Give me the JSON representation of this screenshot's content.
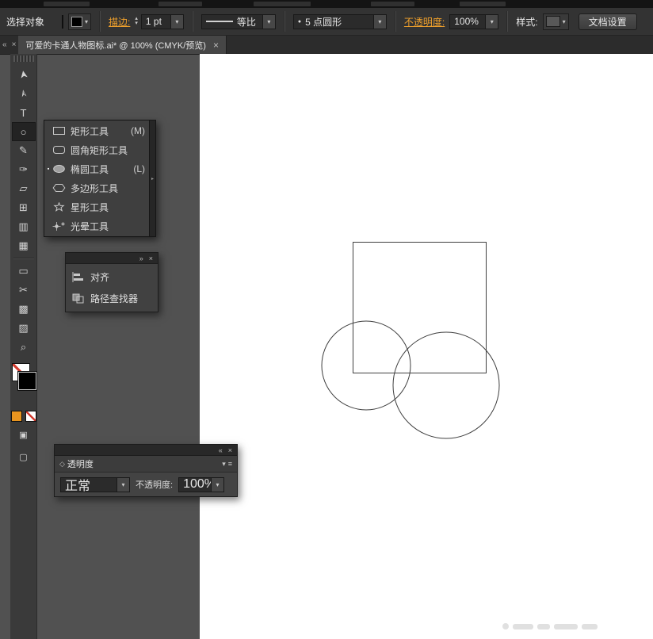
{
  "icons": {
    "chevron_down": "▾",
    "spin_up": "▴",
    "spin_down": "▾",
    "close": "×",
    "collapse_left": "«",
    "collapse_right": "»",
    "menu": "≡",
    "menu_caret": "▾",
    "bullet": "●",
    "diamond": "◇",
    "arrow_right": "▸",
    "selected_marker": "▪",
    "draw_normal": "▣",
    "screen_mode": "▢"
  },
  "controlbar": {
    "selection_label": "选择对象",
    "stroke_label": "描边:",
    "stroke_value": "1 pt",
    "profile_label": "等比",
    "brush_label": "5 点圆形",
    "opacity_label": "不透明度:",
    "opacity_value": "100%",
    "style_label": "样式:",
    "doc_setup": "文档设置"
  },
  "tabbar": {
    "title": "可爱的卡通人物图标.ai* @ 100% (CMYK/预览)"
  },
  "toolbar": {
    "tools": [
      {
        "name": "selection-tool",
        "glyph": "➤"
      },
      {
        "name": "direct-selection-tool",
        "glyph": "➣"
      },
      {
        "name": "type-tool",
        "glyph": "T"
      },
      {
        "name": "ellipse-tool",
        "glyph": "○"
      },
      {
        "name": "pencil-tool",
        "glyph": "✎"
      },
      {
        "name": "paintbrush-tool",
        "glyph": "✑"
      },
      {
        "name": "free-transform-tool",
        "glyph": "▱"
      },
      {
        "name": "shape-builder-tool",
        "glyph": "⊞"
      },
      {
        "name": "column-graph-tool",
        "glyph": "▥"
      },
      {
        "name": "perspective-grid-tool",
        "glyph": "▦"
      },
      {
        "name": "artboard-tool",
        "glyph": "▭"
      },
      {
        "name": "slice-tool",
        "glyph": "✂"
      },
      {
        "name": "mesh-tool",
        "glyph": "▩"
      },
      {
        "name": "gradient-tool",
        "glyph": "▨"
      },
      {
        "name": "zoom-tool",
        "glyph": "⌕"
      }
    ]
  },
  "flyout": {
    "items": [
      {
        "label": "矩形工具",
        "shortcut": "(M)"
      },
      {
        "label": "圆角矩形工具",
        "shortcut": ""
      },
      {
        "label": "椭圆工具",
        "shortcut": "(L)"
      },
      {
        "label": "多边形工具",
        "shortcut": ""
      },
      {
        "label": "星形工具",
        "shortcut": ""
      },
      {
        "label": "光晕工具",
        "shortcut": ""
      }
    ]
  },
  "align_panel": {
    "align_label": "对齐",
    "pathfinder_label": "路径查找器"
  },
  "transparency": {
    "title": "透明度",
    "blend_mode": "正常",
    "opacity_label": "不透明度:",
    "opacity_value": "100%"
  },
  "colors": {
    "accent_orange": "#efa02c",
    "swatch_orange": "#e8941f",
    "none_slash_red": "#d23b2f",
    "canvas": "#ffffff"
  }
}
